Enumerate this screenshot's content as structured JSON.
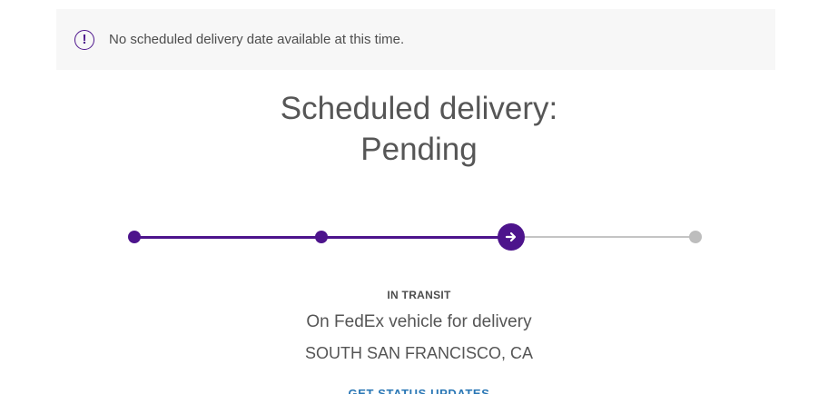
{
  "alert": {
    "icon": "exclamation-circle-icon",
    "message": "No scheduled delivery date available at this time."
  },
  "delivery": {
    "heading_line1": "Scheduled delivery:",
    "heading_line2": "Pending"
  },
  "tracker": {
    "steps": [
      {
        "state": "done"
      },
      {
        "state": "done"
      },
      {
        "state": "current",
        "icon": "arrow-right-icon"
      },
      {
        "state": "pending"
      }
    ],
    "progress_color": "#4d148c",
    "pending_color": "#c4c4c4"
  },
  "status": {
    "label": "IN TRANSIT",
    "description": "On FedEx vehicle for delivery",
    "location": "SOUTH SAN FRANCISCO, CA"
  },
  "actions": {
    "updates_link": "GET STATUS UPDATES"
  }
}
